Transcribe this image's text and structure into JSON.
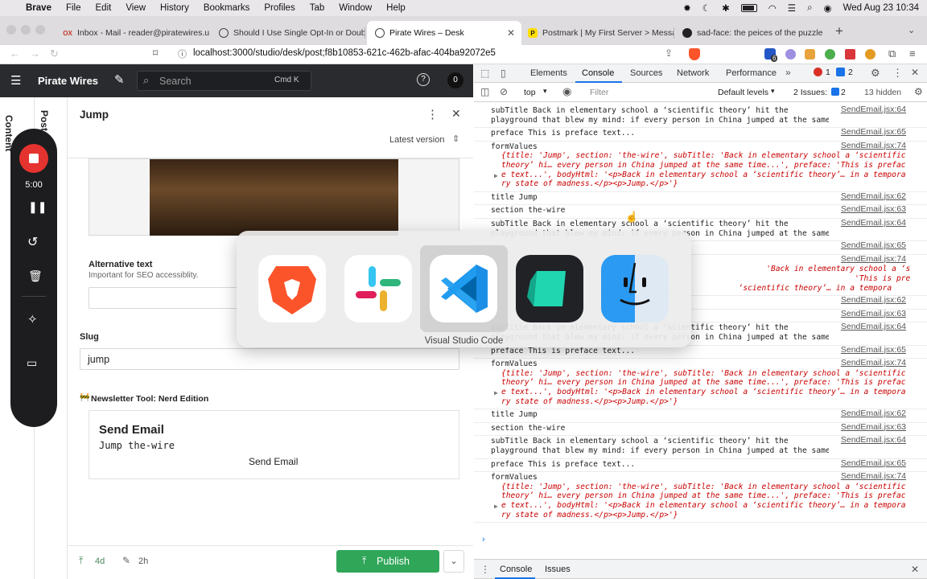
{
  "menubar": {
    "app": "Brave",
    "items": [
      "File",
      "Edit",
      "View",
      "History",
      "Bookmarks",
      "Profiles",
      "Tab",
      "Window",
      "Help"
    ],
    "clock": "Wed Aug 23  10:34"
  },
  "tabs": [
    {
      "title": "Inbox - Mail - reader@piratewires.us",
      "icon": "outlook-icon"
    },
    {
      "title": "Should I Use Single Opt-In or Double",
      "icon": "globe-icon"
    },
    {
      "title": "Pirate Wires – Desk",
      "icon": "globe-icon",
      "active": true
    },
    {
      "title": "Postmark | My First Server > Messa",
      "icon": "postmark-icon"
    },
    {
      "title": "sad-face: the peices of the puzzle",
      "icon": "github-icon"
    }
  ],
  "address": {
    "url": "localhost:3000/studio/desk/post;f8b10853-621c-462b-afac-404ba92072e5",
    "ext_badge": "6"
  },
  "app": {
    "brand": "Pirate Wires",
    "search_placeholder": "Search",
    "search_shortcut": "Cmd K",
    "notif_count": "0",
    "side_labels": [
      "Content",
      "Post"
    ],
    "doc_title": "Jump",
    "version_label": "Latest version",
    "alt_text_label": "Alternative text",
    "alt_text_hint": "Important for SEO accessiblity.",
    "alt_text_value": "",
    "slug_label": "Slug",
    "slug_value": "jump",
    "newsletter_label": "Newsletter Tool: Nerd Edition",
    "newsletter_emoji": "🚧",
    "send_title": "Send Email",
    "send_subtitle": "Jump the-wire",
    "send_button": "Send Email",
    "footer_published": "4d",
    "footer_edited": "2h",
    "publish_button": "Publish"
  },
  "recorder": {
    "time": "5:00"
  },
  "devtools": {
    "tabs": [
      "Elements",
      "Console",
      "Sources",
      "Network",
      "Performance"
    ],
    "active_tab": "Console",
    "context": "top",
    "filter_placeholder": "Filter",
    "levels": "Default levels",
    "issues_label": "2 Issues:",
    "issues_count": "2",
    "errors": "1",
    "warnings": "2",
    "hidden": "13 hidden",
    "drawer_tabs": [
      "Console",
      "Issues"
    ],
    "log": [
      {
        "kind": "line",
        "text": "subTitle Back in elementary school a ‘scientific theory’ hit the\nplayground that blew my mind: if every person in China jumped at the same time...",
        "src": "SendEmail.jsx:64"
      },
      {
        "kind": "line",
        "text": "preface This is preface text...",
        "src": "SendEmail.jsx:65"
      },
      {
        "kind": "obj",
        "text": "formValues",
        "src": "SendEmail.jsx:74",
        "obj": "{title: 'Jump', section: 'the-wire', subTitle: 'Back in elementary school a ‘scientific\ntheory’ hi… every person in China jumped at the same time...', preface: 'This is prefac\ne text...', bodyHtml: '<p>Back in elementary school a ‘scientific theory’… in a tempora\nry state of madness.</p><p>Jump.</p>'}"
      },
      {
        "kind": "line",
        "text": "title Jump",
        "src": "SendEmail.jsx:62"
      },
      {
        "kind": "line",
        "text": "section the-wire",
        "src": "SendEmail.jsx:63"
      },
      {
        "kind": "line",
        "text": "subTitle Back in elementary school a ‘scientific theory’ hit the\nplayground that blew my mind: if every person in China jumped at the same time...",
        "src": "SendEmail.jsx:64"
      },
      {
        "kind": "line",
        "text": "",
        "src": "SendEmail.jsx:65"
      },
      {
        "kind": "obj",
        "text": "",
        "src": "SendEmail.jsx:74",
        "obj": "                                                         'Back in elementary school a ‘scientific\n                                                                            'This is prefac\n                                                   ‘scientific theory’… in a tempora"
      },
      {
        "kind": "line",
        "text": "",
        "src": "SendEmail.jsx:62"
      },
      {
        "kind": "line",
        "text": "",
        "src": "SendEmail.jsx:63"
      },
      {
        "kind": "line",
        "text": "subTitle Back in elementary school a ‘scientific theory’ hit the\nplayground that blew my mind: if every person in China jumped at the same time...",
        "src": "SendEmail.jsx:64"
      },
      {
        "kind": "line",
        "text": "preface This is preface text...",
        "src": "SendEmail.jsx:65"
      },
      {
        "kind": "obj",
        "text": "formValues",
        "src": "SendEmail.jsx:74",
        "obj": "{title: 'Jump', section: 'the-wire', subTitle: 'Back in elementary school a ‘scientific\ntheory’ hi… every person in China jumped at the same time...', preface: 'This is prefac\ne text...', bodyHtml: '<p>Back in elementary school a ‘scientific theory’… in a tempora\nry state of madness.</p><p>Jump.</p>'}"
      },
      {
        "kind": "line",
        "text": "title Jump",
        "src": "SendEmail.jsx:62"
      },
      {
        "kind": "line",
        "text": "section the-wire",
        "src": "SendEmail.jsx:63"
      },
      {
        "kind": "line",
        "text": "subTitle Back in elementary school a ‘scientific theory’ hit the\nplayground that blew my mind: if every person in China jumped at the same time...",
        "src": "SendEmail.jsx:64"
      },
      {
        "kind": "line",
        "text": "preface This is preface text...",
        "src": "SendEmail.jsx:65"
      },
      {
        "kind": "obj",
        "text": "formValues",
        "src": "SendEmail.jsx:74",
        "obj": "{title: 'Jump', section: 'the-wire', subTitle: 'Back in elementary school a ‘scientific\ntheory’ hi… every person in China jumped at the same time...', preface: 'This is prefac\ne text...', bodyHtml: '<p>Back in elementary school a ‘scientific theory’… in a tempora\nry state of madness.</p><p>Jump.</p>'}"
      }
    ]
  },
  "switcher": {
    "apps": [
      {
        "name": "Brave Browser",
        "icon": "brave-lion-icon"
      },
      {
        "name": "Slack",
        "icon": "slack-icon"
      },
      {
        "name": "Visual Studio Code",
        "icon": "vscode-icon",
        "selected": true
      },
      {
        "name": "Linear",
        "icon": "linear-app-icon"
      },
      {
        "name": "Finder",
        "icon": "finder-icon"
      }
    ],
    "selected_label": "Visual Studio Code"
  }
}
